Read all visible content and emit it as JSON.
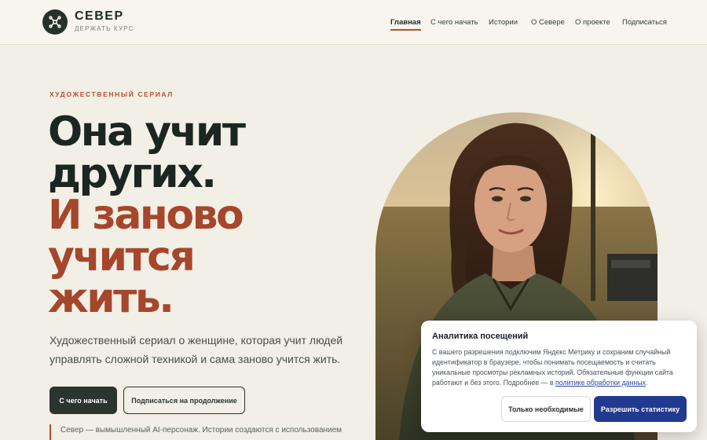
{
  "header": {
    "brand_name": "СЕВЕР",
    "brand_tagline": "ДЕРЖАТЬ КУРС",
    "logo_icon": "compass-drone-icon",
    "nav": [
      {
        "label": "Главная",
        "active": true
      },
      {
        "label": "С чего начать",
        "active": false
      },
      {
        "label": "Истории",
        "active": false
      },
      {
        "label": "О Севере",
        "active": false
      },
      {
        "label": "О проекте",
        "active": false
      },
      {
        "label": "Подписаться",
        "active": false
      }
    ]
  },
  "hero": {
    "eyebrow": "ХУДОЖЕСТВЕННЫЙ СЕРИАЛ",
    "headline_dark": [
      "Она учит",
      "других."
    ],
    "headline_accent": [
      "И заново",
      "учится",
      "жить."
    ],
    "lead": "Художественный сериал о женщине, которая учит людей управлять сложной техникой и сама заново учится жить.",
    "primary_button": "С чего начать",
    "secondary_button": "Подписаться на продолжение",
    "disclaimer": "Север — вымышленный AI-персонаж. Истории создаются с использованием"
  },
  "consent": {
    "title": "Аналитика посещений",
    "text": "С вашего разрешения подключим Яндекс Метрику и сохраним случайный идентификатор в браузере, чтобы понимать посещаемость и считать уникальные просмотры рекламных историй. Обязательные функции сайта работают и без этого. Подробнее — в",
    "link_text": "политике обработки данных",
    "link_suffix": ".",
    "necessary_button": "Только необходимые",
    "allow_button": "Разрешить статистику"
  },
  "colors": {
    "accent": "#b5502f",
    "dark": "#2b352e",
    "consent_primary": "#213a8f"
  }
}
